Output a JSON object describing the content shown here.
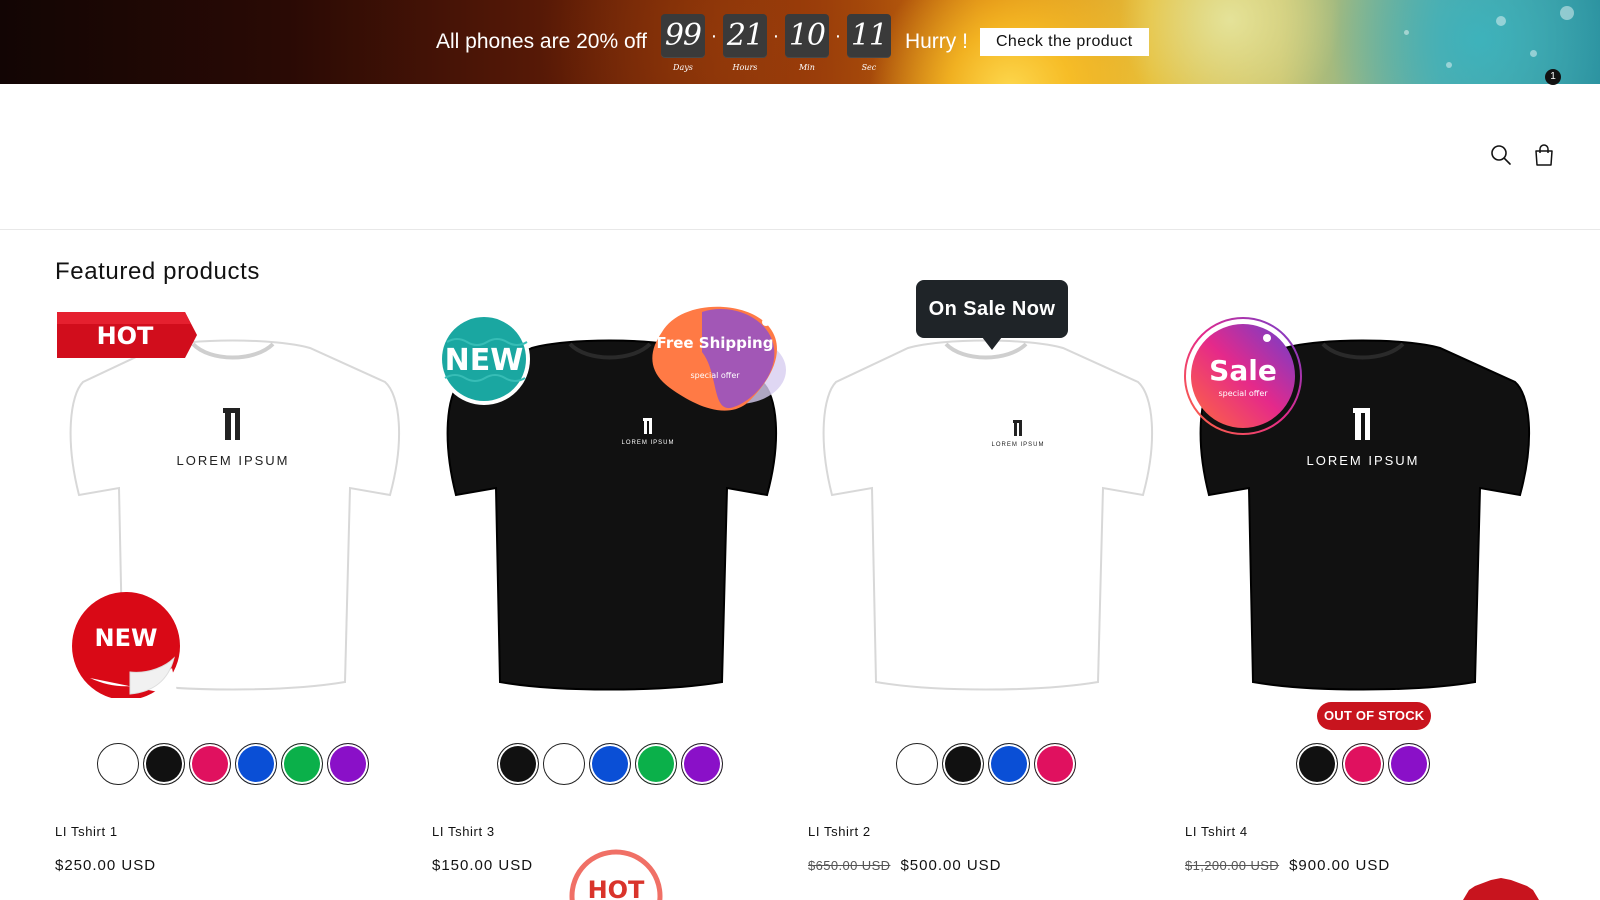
{
  "banner": {
    "promo_text": "All phones are 20% off",
    "countdown": [
      {
        "value": "99",
        "unit": "Days"
      },
      {
        "value": "21",
        "unit": "Hours"
      },
      {
        "value": "10",
        "unit": "Min"
      },
      {
        "value": "11",
        "unit": "Sec"
      }
    ],
    "separator": "·",
    "hurry_text": "Hurry !",
    "cta_label": "Check the product"
  },
  "header": {
    "search_icon": "search-icon",
    "cart_icon": "shopping-bag-icon",
    "cart_count": "1"
  },
  "featured": {
    "title": "Featured products",
    "products": [
      {
        "title": "LI Tshirt 1",
        "price": "$250.00 USD",
        "compare_price": "",
        "shirt_color": "#ffffff",
        "badges": [
          "HOT",
          "NEW"
        ],
        "swatches": [
          "#ffffff",
          "#111111",
          "#e0115f",
          "#0a4fd6",
          "#0bb04a",
          "#8a10c8"
        ]
      },
      {
        "title": "LI Tshirt 3",
        "price": "$150.00 USD",
        "compare_price": "",
        "shirt_color": "#111111",
        "badges": [
          "NEW",
          "Free Shipping",
          "special offer",
          "HOT"
        ],
        "swatches": [
          "#111111",
          "#ffffff",
          "#0a4fd6",
          "#0bb04a",
          "#8a10c8"
        ]
      },
      {
        "title": "LI Tshirt 2",
        "price": "$500.00 USD",
        "compare_price": "$650.00 USD",
        "shirt_color": "#ffffff",
        "badges": [
          "On Sale Now"
        ],
        "swatches": [
          "#ffffff",
          "#111111",
          "#0a4fd6",
          "#e0115f"
        ]
      },
      {
        "title": "LI Tshirt 4",
        "price": "$900.00 USD",
        "compare_price": "$1,200.00 USD",
        "shirt_color": "#111111",
        "badges": [
          "Sale",
          "special offer",
          "OUT OF STOCK"
        ],
        "swatches": [
          "#111111",
          "#e0115f",
          "#8a10c8"
        ]
      }
    ],
    "shirt_logo_text": "LOREM IPSUM"
  }
}
